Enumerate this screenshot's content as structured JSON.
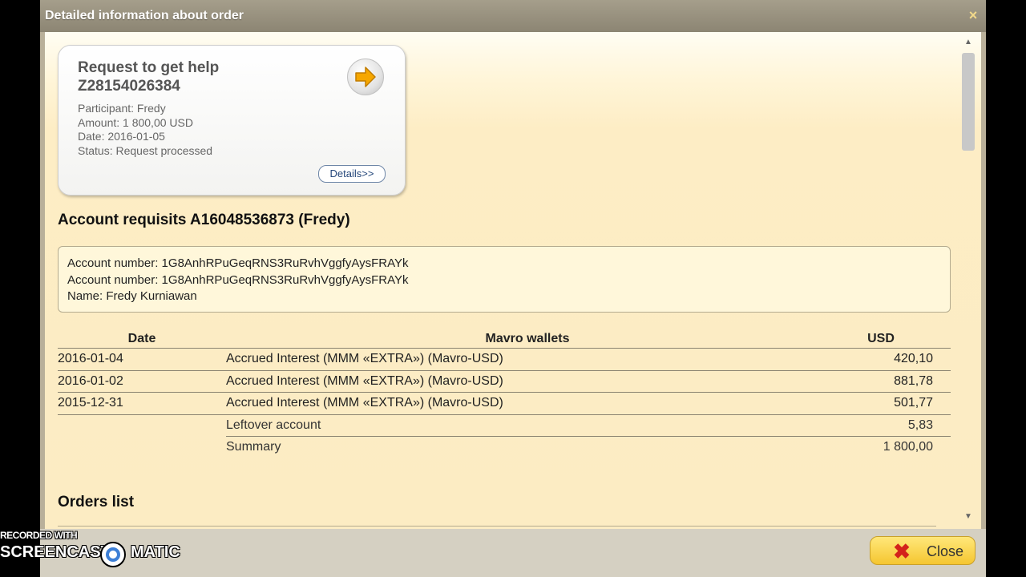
{
  "dialog": {
    "title": "Detailed information about order",
    "close_glyph": "×"
  },
  "request": {
    "title": "Request to get help",
    "id": "Z28154026384",
    "participant": "Participant: Fredy",
    "amount": "Amount: 1 800,00 USD",
    "date": "Date: 2016-01-05",
    "status": "Status: Request processed",
    "details_label": "Details>>",
    "arrow_icon": "arrow-right-icon"
  },
  "requisits": {
    "heading": "Account requisits A16048536873 (Fredy)",
    "lines": [
      "Account number: 1G8AnhRPuGeqRNS3RuRvhVggfyAysFRAYk",
      "Account number: 1G8AnhRPuGeqRNS3RuRvhVggfyAysFRAYk",
      "Name: Fredy Kurniawan"
    ]
  },
  "wallets": {
    "headers": [
      "Date",
      "Mavro wallets",
      "USD"
    ],
    "rows": [
      {
        "date": "2016-01-04",
        "desc": "Accrued Interest (MMM «EXTRA») (Mavro-USD)",
        "usd": "420,10"
      },
      {
        "date": "2016-01-02",
        "desc": "Accrued Interest (MMM «EXTRA») (Mavro-USD)",
        "usd": "881,78"
      },
      {
        "date": "2015-12-31",
        "desc": "Accrued Interest (MMM «EXTRA») (Mavro-USD)",
        "usd": "501,77"
      }
    ],
    "leftover": {
      "label": "Leftover account",
      "usd": "5,83"
    },
    "summary": {
      "label": "Summary",
      "usd": "1 800,00"
    }
  },
  "orders": {
    "heading": "Orders list"
  },
  "footer": {
    "close_label": "Close",
    "close_icon": "red-x-icon"
  },
  "watermark": {
    "line1": "RECORDED WITH",
    "line2_left": "SCREENCAST",
    "line2_right": "MATIC"
  },
  "colors": {
    "accent_button": "#f5c630",
    "close_x": "#d3231b",
    "title_bar": "#8c8573",
    "content_bg": "#fcecc3"
  }
}
